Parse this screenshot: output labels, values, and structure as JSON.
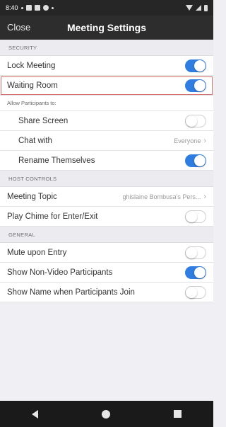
{
  "status_bar": {
    "time": "8:40",
    "icons": [
      "signal-status-icon",
      "notification-icon",
      "sync-icon",
      "dot-icon",
      "wifi-icon",
      "battery-icon"
    ]
  },
  "header": {
    "close_label": "Close",
    "title": "Meeting Settings"
  },
  "sections": {
    "security": {
      "title": "SECURITY",
      "lock_meeting": {
        "label": "Lock Meeting",
        "on": true
      },
      "waiting_room": {
        "label": "Waiting Room",
        "on": true
      },
      "allow_label": "Allow Participants to:",
      "share_screen": {
        "label": "Share Screen",
        "on": false
      },
      "chat_with": {
        "label": "Chat with",
        "value": "Everyone"
      },
      "rename_themselves": {
        "label": "Rename Themselves",
        "on": true
      }
    },
    "host_controls": {
      "title": "HOST CONTROLS",
      "meeting_topic": {
        "label": "Meeting Topic",
        "value": "ghislaine Bombusa's Pers..."
      },
      "play_chime": {
        "label": "Play Chime for Enter/Exit",
        "on": false
      }
    },
    "general": {
      "title": "GENERAL",
      "mute_upon_entry": {
        "label": "Mute upon Entry",
        "on": false
      },
      "show_non_video": {
        "label": "Show Non-Video Participants",
        "on": true
      },
      "show_name_join": {
        "label": "Show Name when Participants Join",
        "on": false
      }
    }
  },
  "colors": {
    "accent": "#2f7de1",
    "highlight_border": "#d46a6a",
    "header_bg": "#2d2d2d"
  }
}
